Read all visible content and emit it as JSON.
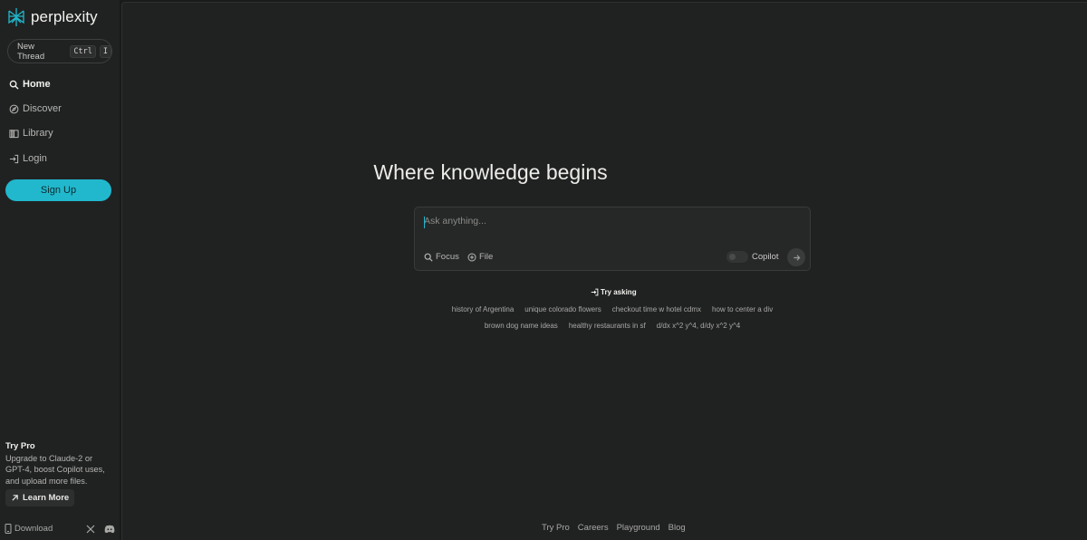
{
  "brand": {
    "name": "perplexity",
    "accent": "#21b8cd"
  },
  "sidebar": {
    "new_thread": {
      "label": "New Thread",
      "kbd": [
        "Ctrl",
        "I"
      ]
    },
    "items": [
      {
        "label": "Home",
        "icon": "search-icon"
      },
      {
        "label": "Discover",
        "icon": "compass-icon"
      },
      {
        "label": "Library",
        "icon": "library-icon"
      },
      {
        "label": "Login",
        "icon": "login-icon"
      }
    ],
    "signup_label": "Sign Up",
    "try_pro": {
      "title": "Try Pro",
      "description": "Upgrade to Claude-2 or GPT-4, boost Copilot uses, and upload more files.",
      "learn_more": "Learn More"
    },
    "download_label": "Download",
    "social": [
      "x-icon",
      "discord-icon"
    ]
  },
  "main": {
    "headline": "Where knowledge begins",
    "search": {
      "placeholder": "Ask anything...",
      "focus_label": "Focus",
      "file_label": "File",
      "copilot_label": "Copilot",
      "copilot_on": false
    },
    "try_asking": {
      "label": "Try asking",
      "row1": [
        "history of Argentina",
        "unique colorado flowers",
        "checkout time w hotel cdmx",
        "how to center a div"
      ],
      "row2": [
        "brown dog name ideas",
        "healthy restaurants in sf",
        "d/dx x^2 y^4, d/dy x^2 y^4"
      ]
    },
    "footer": [
      "Try Pro",
      "Careers",
      "Playground",
      "Blog"
    ]
  }
}
